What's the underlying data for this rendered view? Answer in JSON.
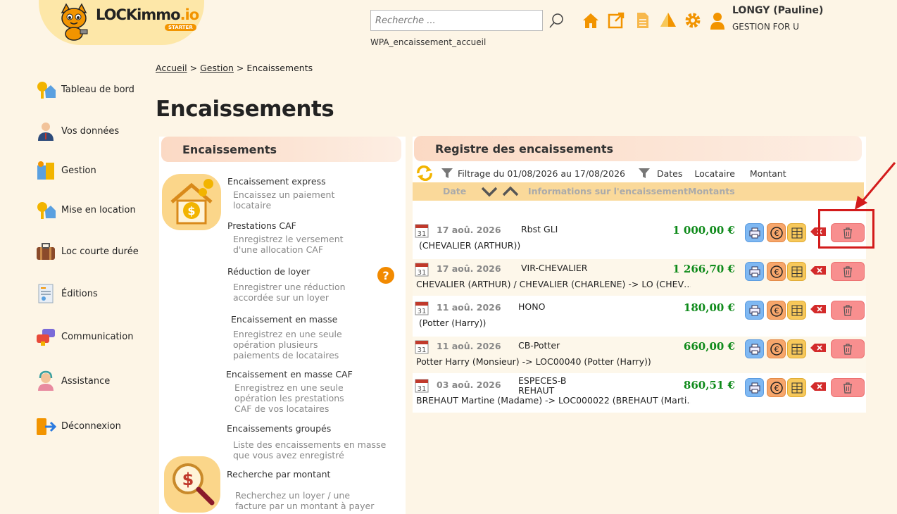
{
  "header": {
    "logo_main": "LOCKimmo",
    "logo_suffix": ".io",
    "logo_badge": "STARTER",
    "search_placeholder": "Recherche ...",
    "page_code": "WPA_encaissement_accueil",
    "user_name": "LONGY (Pauline)",
    "user_company": "GESTION FOR U",
    "icons": [
      "home-icon",
      "external-link-icon",
      "document-icon",
      "tent-icon",
      "gear-icon",
      "user-icon"
    ],
    "accent_color": "#f29400"
  },
  "sidebar": {
    "items": [
      {
        "label": "Tableau de bord",
        "icon": "key-house-icon"
      },
      {
        "label": "Vos données",
        "icon": "person-icon"
      },
      {
        "label": "Gestion",
        "icon": "management-icon"
      },
      {
        "label": "Mise en location",
        "icon": "key-house-icon"
      },
      {
        "label": "Loc courte durée",
        "icon": "suitcase-icon"
      },
      {
        "label": "Éditions",
        "icon": "report-icon"
      },
      {
        "label": "Communication",
        "icon": "chat-icon"
      },
      {
        "label": "Assistance",
        "icon": "support-icon"
      },
      {
        "label": "Déconnexion",
        "icon": "logout-icon"
      }
    ]
  },
  "breadcrumb": {
    "home": "Accueil",
    "section": "Gestion",
    "current": "Encaissements",
    "sep": ">"
  },
  "page_title": "Encaissements",
  "left_panel": {
    "title": "Encaissements",
    "options": [
      {
        "title": "Encaissement express",
        "desc": [
          "Encaissez un paiement",
          "locataire"
        ]
      },
      {
        "title": "Prestations CAF",
        "desc": [
          "Enregistrez le versement",
          "d'une allocation CAF"
        ]
      },
      {
        "title": "Réduction de loyer",
        "desc": [
          "Enregistrer une réduction",
          "accordée sur un loyer"
        ]
      },
      {
        "title": "Encaissement en masse",
        "desc": [
          "Enregistrez en une seule",
          "opération plusieurs",
          "paiements de locataires"
        ]
      },
      {
        "title": "Encaissement en masse CAF",
        "desc": [
          "Enregistrez en une seule",
          "opération les prestations",
          "CAF de vos locataires"
        ]
      },
      {
        "title": "Encaissements groupés",
        "desc": [
          "Liste des encaissements en masse",
          "que vous avez enregistré"
        ]
      },
      {
        "title": "Recherche par montant",
        "desc": [
          "Recherchez un loyer / une",
          "facture par un montant à payer"
        ]
      }
    ],
    "help": "?"
  },
  "register": {
    "title": "Registre des encaissements",
    "filter_text": "Filtrage du 01/08/2026 au 17/08/2026",
    "filter_dates": "Dates",
    "filter_tenant": "Locataire",
    "filter_amount": "Montant",
    "col_date": "Date",
    "col_info": "Informations sur l'encaissement",
    "col_amounts": "Montants",
    "rows": [
      {
        "day": "31",
        "date": "17 aoû. 2026",
        "label": "Rbst GLI",
        "amount": "1 000,00 €",
        "sub": "(CHEVALIER (ARTHUR))"
      },
      {
        "day": "31",
        "date": "17 aoû. 2026",
        "label": "VIR-CHEVALIER",
        "amount": "1 266,70 €",
        "sub": "CHEVALIER (ARTHUR) / CHEVALIER (CHARLENE) -> LO (CHEV…"
      },
      {
        "day": "31",
        "date": "11 aoû. 2026",
        "label": "HONO",
        "amount": "180,00 €",
        "sub": "(Potter (Harry))"
      },
      {
        "day": "31",
        "date": "11 aoû. 2026",
        "label": "CB-Potter",
        "amount": "660,00 €",
        "sub": "Potter Harry (Monsieur) -> LOC00040 (Potter (Harry))"
      },
      {
        "day": "31",
        "date": "03 aoû. 2026",
        "label": "ESPECES-BREHAUT",
        "amount": "860,51 €",
        "sub": "BREHAUT Martine (Madame) -> LOC000022 (BREHAUT (Marti…"
      }
    ]
  }
}
